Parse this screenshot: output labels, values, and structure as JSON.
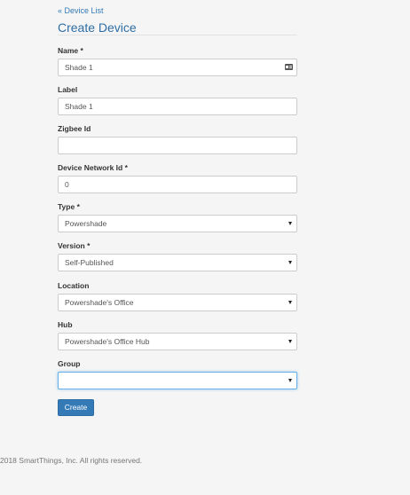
{
  "nav": {
    "back_label": "« Device List"
  },
  "page": {
    "title": "Create Device"
  },
  "form": {
    "name": {
      "label": "Name *",
      "value": "Shade 1"
    },
    "label": {
      "label": "Label",
      "value": "Shade 1"
    },
    "zigbee_id": {
      "label": "Zigbee Id",
      "value": ""
    },
    "device_network_id": {
      "label": "Device Network Id *",
      "value": "0"
    },
    "type": {
      "label": "Type *",
      "value": "Powershade"
    },
    "version": {
      "label": "Version *",
      "value": "Self-Published"
    },
    "location": {
      "label": "Location",
      "value": "Powershade's Office"
    },
    "hub": {
      "label": "Hub",
      "value": "Powershade's Office Hub"
    },
    "group": {
      "label": "Group",
      "value": ""
    },
    "submit_label": "Create"
  },
  "footer": {
    "text": "2018 SmartThings, Inc. All rights reserved."
  },
  "colors": {
    "link": "#337ab7",
    "title": "#2e6da4",
    "primary_button": "#337ab7",
    "focus_border": "#66afe9",
    "background": "#f5f5f5"
  },
  "icons": {
    "name_field_icon": "contact-card-icon",
    "select_arrow": "caret-down-icon"
  }
}
